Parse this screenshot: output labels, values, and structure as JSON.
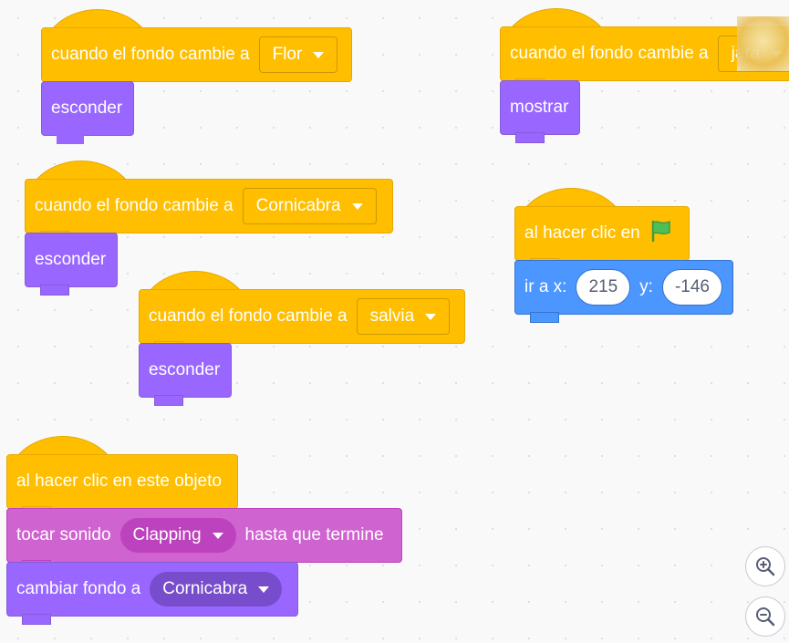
{
  "hat_label": "cuando el fondo cambie a",
  "stack1": {
    "backdrop": "Flor",
    "action": "esconder"
  },
  "stack2": {
    "backdrop": "Cornicabra",
    "action": "esconder"
  },
  "stack3": {
    "backdrop": "salvia",
    "action": "esconder"
  },
  "stack4": {
    "backdrop": "jara",
    "action": "mostrar"
  },
  "green_flag": {
    "label": "al hacer clic en",
    "goto_x_label": "ir a x:",
    "x_value": "215",
    "goto_y_label": "y:",
    "y_value": "-146"
  },
  "sprite_click": {
    "label": "al hacer clic en este objeto",
    "sound_prefix": "tocar sonido",
    "sound": "Clapping",
    "sound_suffix": "hasta que termine",
    "switch_label": "cambiar fondo a",
    "switch_backdrop": "Cornicabra"
  },
  "icons": {
    "flag": "green-flag-icon",
    "zoom_in": "zoom-in-icon",
    "zoom_out": "zoom-out-icon"
  },
  "colors": {
    "events": "#ffbf00",
    "looks": "#9966ff",
    "sound": "#cf63cf",
    "motion": "#4c97ff"
  }
}
